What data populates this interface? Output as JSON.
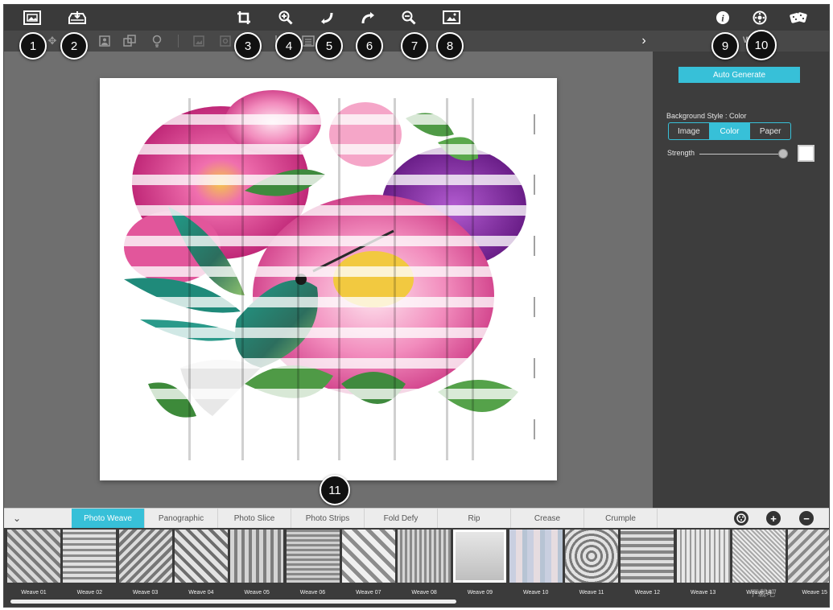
{
  "panel": {
    "header_fragment": "W",
    "auto_generate": "Auto Generate",
    "background_style_label": "Background Style : Color",
    "style_options": [
      "Image",
      "Color",
      "Paper"
    ],
    "style_selected": "Color",
    "strength_label": "Strength",
    "strength_level": 0.98,
    "swatch_color": "#ffffff"
  },
  "tabs": [
    "Photo Weave",
    "Panographic",
    "Photo Slice",
    "Photo Strips",
    "Fold Defy",
    "Rip",
    "Crease",
    "Crumple"
  ],
  "active_tab": "Photo Weave",
  "thumbnails": [
    "Weave 01",
    "Weave 02",
    "Weave 03",
    "Weave 04",
    "Weave 05",
    "Weave 06",
    "Weave 07",
    "Weave 08",
    "Weave 09",
    "Weave 10",
    "Weave 11",
    "Weave 12",
    "Weave 13",
    "Weave 14",
    "Weave 15"
  ],
  "selected_thumbnail": "Weave 09",
  "badges": [
    "1",
    "2",
    "3",
    "4",
    "5",
    "6",
    "7",
    "8",
    "9",
    "10",
    "11"
  ],
  "icons": {
    "open_image": "open-image-icon",
    "save": "save-icon",
    "crop": "crop-icon",
    "zoom_in": "zoom-in-icon",
    "undo": "undo-icon",
    "redo": "redo-icon",
    "zoom_out": "zoom-out-icon",
    "fit": "fit-image-icon",
    "info": "info-icon",
    "settings": "settings-icon",
    "dice": "dice-icon",
    "panel_toggle": "chevron-right-icon"
  },
  "colors": {
    "accent": "#37c0d8",
    "toolbar": "#3a3a3a",
    "canvas": "#6f6f6f",
    "panel": "#3d3d3d",
    "tabbar": "#ececec"
  },
  "watermark": "下载吧"
}
